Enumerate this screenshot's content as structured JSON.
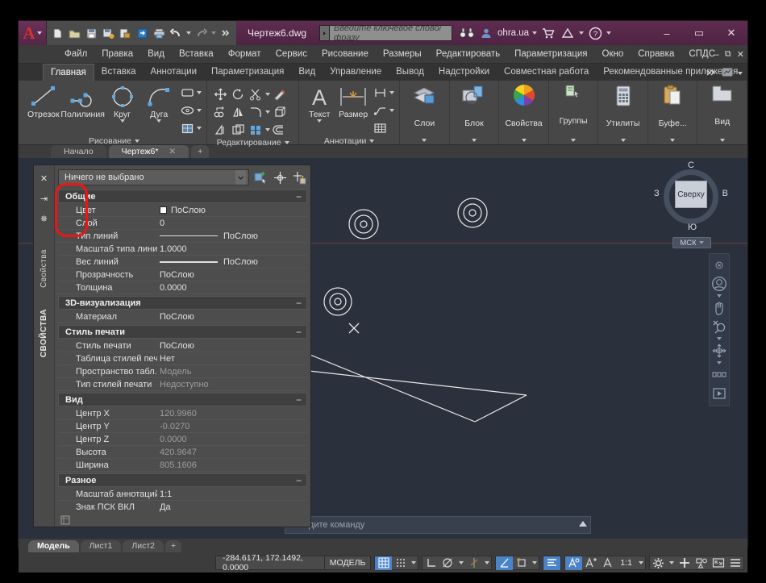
{
  "titlebar": {
    "logo": "A",
    "document": "Чертеж6.dwg",
    "search_placeholder": "Введите ключевое слово/фразу",
    "user": "ohra.ua",
    "quick_access": [
      {
        "name": "new-icon",
        "label": "Создать"
      },
      {
        "name": "open-icon",
        "label": "Открыть"
      },
      {
        "name": "save-icon",
        "label": "Сохранить"
      },
      {
        "name": "save-as-icon",
        "label": "Сохранить как"
      },
      {
        "name": "export-icon",
        "label": "Экспорт"
      },
      {
        "name": "import-icon",
        "label": "Импорт"
      },
      {
        "name": "print-icon",
        "label": "Печать"
      },
      {
        "name": "undo-icon",
        "label": "Отменить"
      },
      {
        "name": "redo-icon",
        "label": "Вернуть"
      }
    ],
    "window_buttons": [
      "–",
      "▭",
      "✕"
    ]
  },
  "menubar": {
    "items": [
      "Файл",
      "Правка",
      "Вид",
      "Вставка",
      "Формат",
      "Сервис",
      "Рисование",
      "Размеры",
      "Редактировать",
      "Параметризация",
      "Окно",
      "Справка",
      "СПДС"
    ],
    "window_controls": [
      "–",
      "⧉",
      "✕"
    ]
  },
  "ribbon_tabs": {
    "items": [
      "Главная",
      "Вставка",
      "Аннотации",
      "Параметризация",
      "Вид",
      "Управление",
      "Вывод",
      "Надстройки",
      "Совместная работа",
      "Рекомендованные приложения"
    ],
    "active": "Главная"
  },
  "ribbon": {
    "panels": [
      {
        "title": "Рисование",
        "big_buttons": [
          {
            "label": "Отрезок",
            "icon": "line-icon"
          },
          {
            "label": "Полилиния",
            "icon": "polyline-icon"
          },
          {
            "label": "Круг",
            "icon": "circle-icon"
          },
          {
            "label": "Дуга",
            "icon": "arc-icon"
          }
        ],
        "small_icons": [
          "rectangle-icon",
          "ellipse-icon",
          "hatch-icon"
        ]
      },
      {
        "title": "Редактирование",
        "small_icons": [
          "move-icon",
          "rotate-icon",
          "trim-icon",
          "erase-icon",
          "copy-icon",
          "mirror-icon",
          "fillet-icon",
          "array-icon",
          "stretch-icon",
          "scale-icon",
          "explode-icon",
          "offset-icon"
        ]
      },
      {
        "title": "Аннотации",
        "big_buttons": [
          {
            "label": "Текст",
            "icon": "text-icon"
          },
          {
            "label": "Размер",
            "icon": "dimension-icon"
          }
        ],
        "small_icons": [
          "linear-dim-icon",
          "leader-icon",
          "table-icon"
        ]
      }
    ],
    "vertical_panels": [
      {
        "label": "Слои",
        "icon": "layers-icon"
      },
      {
        "label": "Блок",
        "icon": "block-icon"
      },
      {
        "label": "Свойства",
        "icon": "properties-wheel-icon"
      },
      {
        "label": "Группы",
        "icon": "groups-icon"
      },
      {
        "label": "Утилиты",
        "icon": "utilities-icon"
      },
      {
        "label": "Буфе...",
        "icon": "clipboard-icon"
      },
      {
        "label": "Вид",
        "icon": "view-icon"
      }
    ]
  },
  "file_tabs": {
    "items": [
      {
        "label": "Начало",
        "active": false,
        "closable": false
      },
      {
        "label": "Чертеж6*",
        "active": true,
        "closable": true
      }
    ],
    "add_label": "+"
  },
  "properties": {
    "side_label_top": "Свойства",
    "side_label_bottom": "СВОЙСТВА",
    "side_buttons": [
      {
        "name": "close-icon",
        "glyph": "✕"
      },
      {
        "name": "auto-hide-icon",
        "glyph": "⇥"
      },
      {
        "name": "palette-settings-icon",
        "glyph": "✵"
      }
    ],
    "selection": "Ничего не выбрано",
    "toolbar_icons": [
      "quick-select-icon",
      "select-objects-icon",
      "quick-calc-icon"
    ],
    "groups": [
      {
        "title": "Общие",
        "rows": [
          {
            "name": "Цвет",
            "value": "ПоСлою",
            "type": "color"
          },
          {
            "name": "Слой",
            "value": "0",
            "type": "text"
          },
          {
            "name": "Тип линий",
            "value": "ПоСлою",
            "type": "linetype"
          },
          {
            "name": "Масштаб типа линий",
            "value": "1.0000",
            "type": "text"
          },
          {
            "name": "Вес линий",
            "value": "ПоСлою",
            "type": "linetype"
          },
          {
            "name": "Прозрачность",
            "value": "ПоСлою",
            "type": "text"
          },
          {
            "name": "Толщина",
            "value": "0.0000",
            "type": "text"
          }
        ]
      },
      {
        "title": "3D-визуализация",
        "rows": [
          {
            "name": "Материал",
            "value": "ПоСлою",
            "type": "text"
          }
        ]
      },
      {
        "title": "Стиль печати",
        "rows": [
          {
            "name": "Стиль печати",
            "value": "ПоСлою",
            "type": "text"
          },
          {
            "name": "Таблица стилей печ...",
            "value": "Нет",
            "type": "text"
          },
          {
            "name": "Пространство табл...",
            "value": "Модель",
            "type": "dim"
          },
          {
            "name": "Тип стилей печати",
            "value": "Недоступно",
            "type": "dim"
          }
        ]
      },
      {
        "title": "Вид",
        "rows": [
          {
            "name": "Центр X",
            "value": "120.9960",
            "type": "dim"
          },
          {
            "name": "Центр Y",
            "value": "-0.0270",
            "type": "dim"
          },
          {
            "name": "Центр Z",
            "value": "0.0000",
            "type": "dim"
          },
          {
            "name": "Высота",
            "value": "420.9647",
            "type": "dim"
          },
          {
            "name": "Ширина",
            "value": "805.1606",
            "type": "dim"
          }
        ]
      },
      {
        "title": "Разное",
        "rows": [
          {
            "name": "Масштаб аннотаций",
            "value": "1:1",
            "type": "text"
          },
          {
            "name": "Знак ПСК ВКЛ",
            "value": "Да",
            "type": "text"
          }
        ]
      }
    ]
  },
  "canvas": {
    "viewcube": {
      "face": "Сверху",
      "north": "С",
      "south": "Ю",
      "west": "З",
      "east": "В"
    },
    "ucs": "МСК",
    "command_placeholder": "Введите команду",
    "nav_icons": [
      "steering-wheel-icon",
      "pan-icon",
      "zoom-icon",
      "orbit-icon",
      "showmotion-icon"
    ]
  },
  "layout_tabs": {
    "items": [
      "Модель",
      "Лист1",
      "Лист2"
    ],
    "active": "Модель",
    "add_label": "+"
  },
  "status_bar": {
    "coordinates": "-284.6171, 172.1492, 0.0000",
    "space": "МОДЕЛЬ",
    "scale": "1:1",
    "toggles": [
      {
        "name": "grid-toggle",
        "active": true
      },
      {
        "name": "snap-toggle",
        "active": false
      },
      {
        "name": "ortho-toggle",
        "active": false
      },
      {
        "name": "polar-toggle",
        "active": false
      },
      {
        "name": "osnap-toggle",
        "active": false
      },
      {
        "name": "otrack-toggle",
        "active": true
      },
      {
        "name": "ducs-toggle",
        "active": false
      },
      {
        "name": "dyn-toggle",
        "active": true
      },
      {
        "name": "lineweight-toggle",
        "active": true
      },
      {
        "name": "transparency-toggle",
        "active": false
      },
      {
        "name": "annotation-toggle",
        "active": false
      }
    ]
  },
  "colors": {
    "title_bar": "#4e2443",
    "ribbon": "#474747",
    "canvas": "#2a303c",
    "accent": "#4b83c8",
    "annotation_red": "#f01515"
  }
}
